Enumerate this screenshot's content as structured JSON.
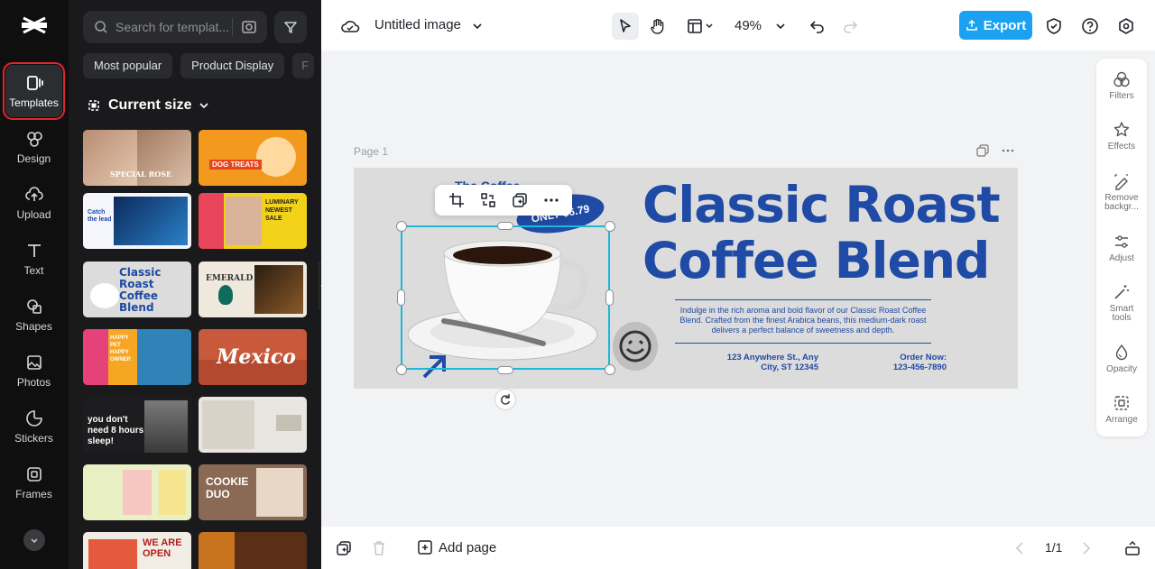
{
  "sidebar": {
    "items": [
      {
        "label": "Templates",
        "icon": "templates-icon"
      },
      {
        "label": "Design",
        "icon": "design-icon"
      },
      {
        "label": "Upload",
        "icon": "upload-icon"
      },
      {
        "label": "Text",
        "icon": "text-icon"
      },
      {
        "label": "Shapes",
        "icon": "shapes-icon"
      },
      {
        "label": "Photos",
        "icon": "photos-icon"
      },
      {
        "label": "Stickers",
        "icon": "stickers-icon"
      },
      {
        "label": "Frames",
        "icon": "frames-icon"
      }
    ]
  },
  "templates_panel": {
    "search_placeholder": "Search for templat...",
    "chips": [
      "Most popular",
      "Product Display",
      "F"
    ],
    "size_title": "Current size",
    "thumbs": [
      {
        "text": "SPECIAL ROSE",
        "bg": "#c9a58c"
      },
      {
        "text": "DOG TREATS",
        "bg": "#f39a1e"
      },
      {
        "text": "Catch the lead",
        "bg": "#f4f6fb"
      },
      {
        "text": "LUMINARY NEWEST SALE",
        "bg": "#f3d21a"
      },
      {
        "text": "Classic Roast Coffee Blend",
        "bg": "#dcdcdc"
      },
      {
        "text": "EMERALD",
        "bg": "#efe8dc"
      },
      {
        "text": "HAPPY PET HAPPY OWNER",
        "bg": "#f7a623"
      },
      {
        "text": "Mexico",
        "bg": "#c8593a"
      },
      {
        "text": "you don't need 8 hours sleep!",
        "bg": "#1d1d1f"
      },
      {
        "text": "",
        "bg": "#e9e6e1"
      },
      {
        "text": "",
        "bg": "#e8f0c4"
      },
      {
        "text": "COOKIE DUO",
        "bg": "#8a6a55"
      },
      {
        "text": "WE ARE OPEN",
        "bg": "#f1ece4"
      },
      {
        "text": "",
        "bg": "#5b2e18"
      }
    ]
  },
  "topbar": {
    "title": "Untitled image",
    "zoom": "49%",
    "export_label": "Export"
  },
  "canvas": {
    "page_label": "Page 1",
    "headline_line1": "Classic Roast",
    "headline_line2": "Coffee Blend",
    "description": "Indulge in the rich aroma and bold flavor of our Classic Roast Coffee Blend. Crafted from the finest Arabica beans, this medium-dark roast delivers a perfect balance of sweetness and depth.",
    "address_line1": "123 Anywhere St., Any",
    "address_line2": "City, ST 12345",
    "order_label": "Order Now:",
    "order_phone": "123-456-7890",
    "small_title": "The Coffee",
    "price_badge": "ONLY $6.79"
  },
  "tools": [
    {
      "label": "Filters"
    },
    {
      "label": "Effects"
    },
    {
      "label": "Remove backgr..."
    },
    {
      "label": "Adjust"
    },
    {
      "label": "Smart tools"
    },
    {
      "label": "Opacity"
    },
    {
      "label": "Arrange"
    }
  ],
  "bottombar": {
    "add_page": "Add page",
    "page_count": "1/1"
  },
  "colors": {
    "accent": "#1ba1f2",
    "brand_blue": "#1f4aa5",
    "selection": "#1bb8d8",
    "active_outline": "#e0262d"
  }
}
